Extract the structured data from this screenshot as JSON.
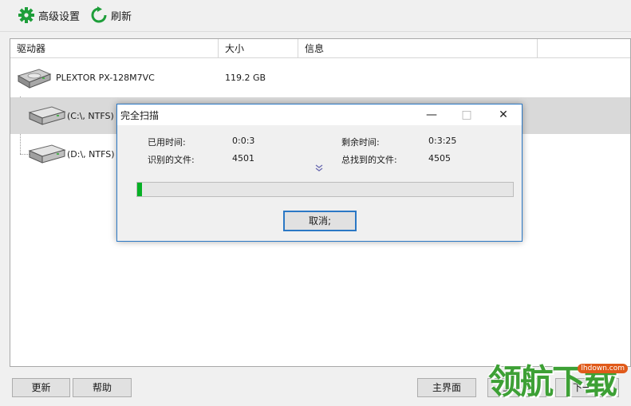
{
  "toolbar": {
    "advanced_label": "高级设置",
    "refresh_label": "刷新"
  },
  "columns": {
    "drive": "驱动器",
    "size": "大小",
    "info": "信息"
  },
  "drives": {
    "disk": {
      "name": "PLEXTOR PX-128M7VC",
      "size": "119.2 GB"
    },
    "c": {
      "name": "(C:\\, NTFS)"
    },
    "d": {
      "name": "(D:\\, NTFS)"
    }
  },
  "dialog": {
    "title": "完全扫描",
    "minimize": "—",
    "maximize": "□",
    "close": "✕",
    "elapsed_label": "已用时间:",
    "elapsed_value": "0:0:3",
    "remaining_label": "剩余时间:",
    "remaining_value": "0:3:25",
    "identified_label": "识别的文件:",
    "identified_value": "4501",
    "found_label": "总找到的文件:",
    "found_value": "4505",
    "expand_glyph": "⌄",
    "progress_fraction": 0.013,
    "cancel_label": "取消;"
  },
  "bottom": {
    "update_label": "更新",
    "help_label": "帮助",
    "main_label": "主界面",
    "prev_label": "上一步",
    "next_label": "下一步"
  },
  "watermark": {
    "text": "领航下载",
    "url": "lhdown.com"
  },
  "colors": {
    "accent": "#2b78c5",
    "progress": "#06b025",
    "icon_green": "#1e9e3a"
  }
}
